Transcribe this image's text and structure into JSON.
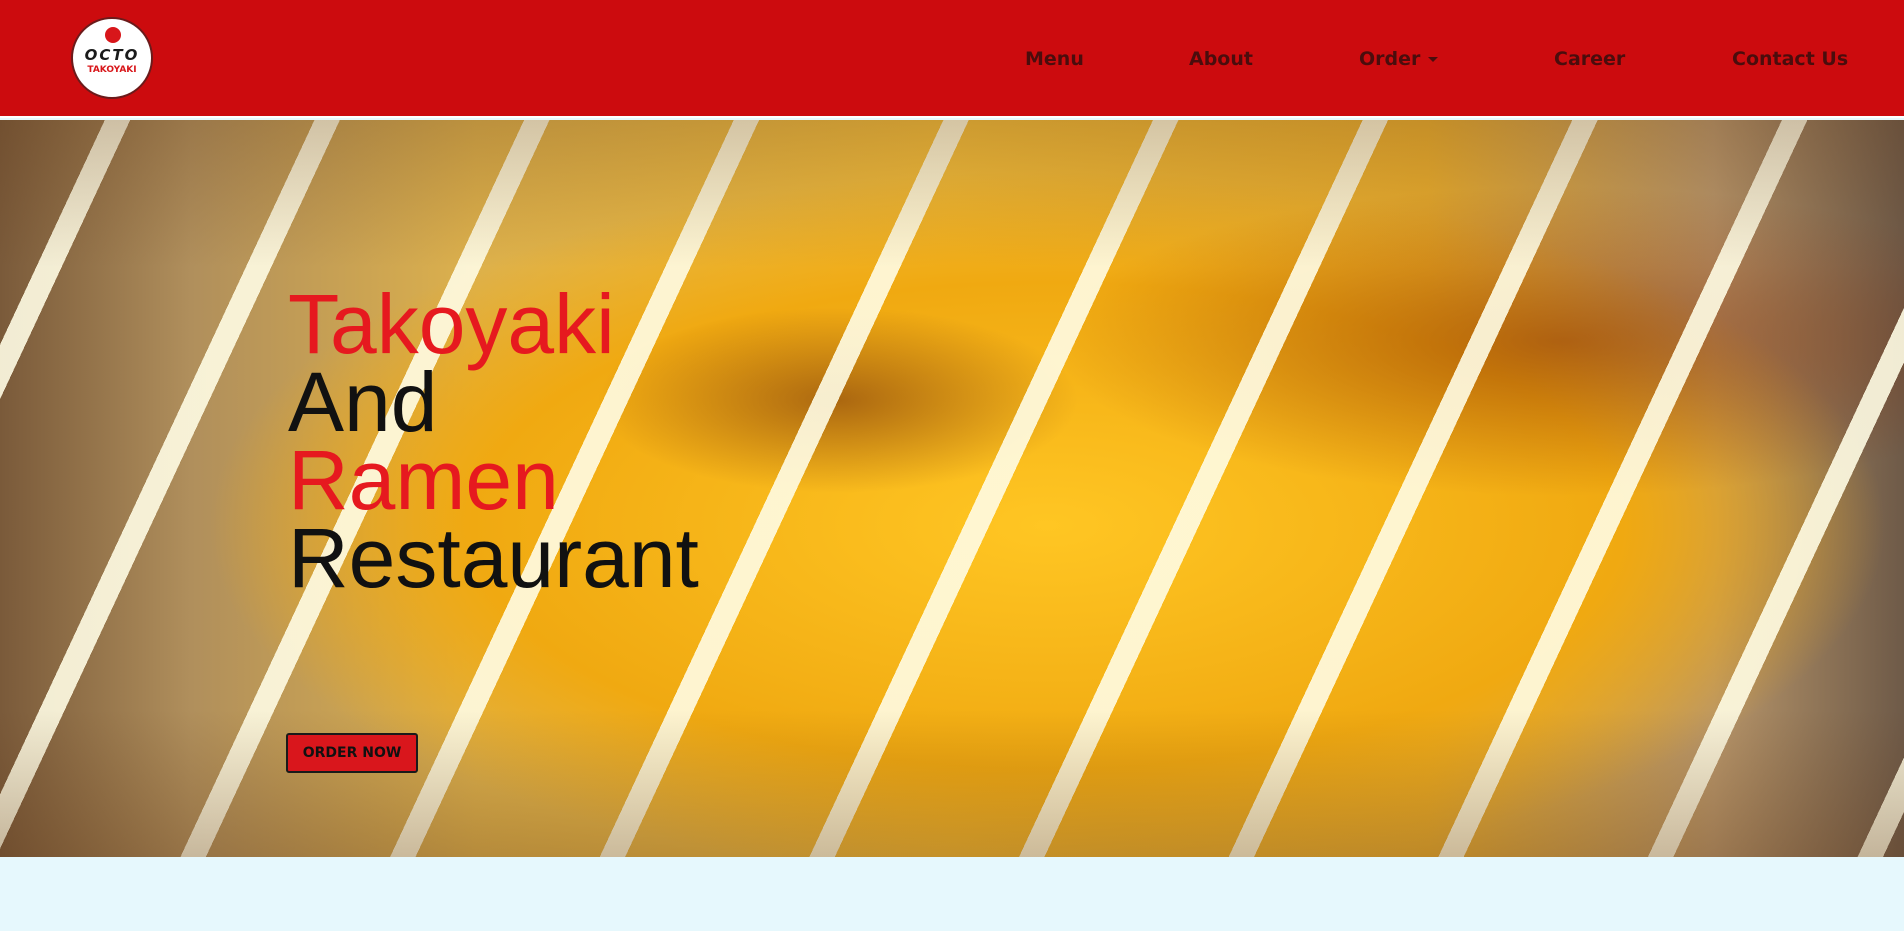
{
  "brand": {
    "logo_word": "OCTO",
    "logo_sub": "TAKOYAKI"
  },
  "nav": {
    "items": [
      {
        "label": "Menu"
      },
      {
        "label": "About"
      },
      {
        "label": "Order"
      },
      {
        "label": "Career"
      },
      {
        "label": "Contact Us"
      }
    ]
  },
  "hero": {
    "line1": "Takoyaki",
    "line2": "And",
    "line3": "Ramen",
    "line4": "Restaurant",
    "cta_label": "ORDER NOW"
  },
  "colors": {
    "navbar": "#cc0b0e",
    "accent_red": "#e6191f",
    "page_background": "#e6f8fd"
  }
}
